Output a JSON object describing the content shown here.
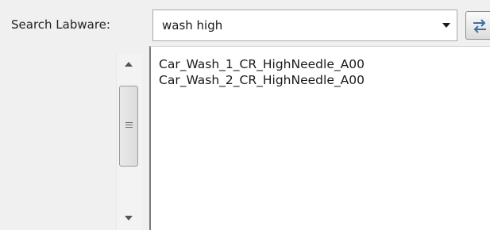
{
  "search": {
    "label": "Search Labware:",
    "value": "wash high",
    "dropdown_icon": "chevron-down-icon",
    "swap_icon": "swap-arrows-icon"
  },
  "scrollbar": {
    "up_icon": "scroll-up-arrow-icon",
    "down_icon": "scroll-down-arrow-icon",
    "grip_icon": "grip-lines-icon"
  },
  "results": {
    "items": [
      {
        "label": "Car_Wash_1_CR_HighNeedle_A00"
      },
      {
        "label": "Car_Wash_2_CR_HighNeedle_A00"
      }
    ]
  },
  "colors": {
    "background": "#f0f0f0",
    "list_background": "#ffffff",
    "text": "#1a1a1a",
    "swap_icon_accent": "#3a6ea5"
  }
}
